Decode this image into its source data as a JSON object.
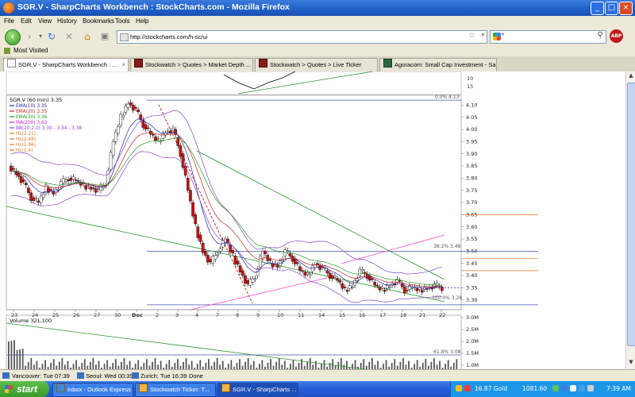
{
  "window": {
    "title": "SGR.V - SharpCharts Workbench : StockCharts.com - Mozilla Firefox"
  },
  "menu": [
    "File",
    "Edit",
    "View",
    "History",
    "Bookmarks",
    "Tools",
    "Help"
  ],
  "nav": {
    "url": "http://stockcharts.com/h-sc/ui",
    "search_value": ""
  },
  "bookmarks": {
    "most_visited": "Most Visited"
  },
  "tabs": [
    {
      "label": "SGR.V - SharpCharts Workbench : ...",
      "active": true
    },
    {
      "label": "Stockwatch > Quotes > Market Depth ...",
      "active": false
    },
    {
      "label": "Stockwatch > Quotes > Live Ticker",
      "active": false
    },
    {
      "label": "Agoracom: Small Cap Investment - San...",
      "active": false
    }
  ],
  "status": {
    "vancouver": "Vancouver: Tue 07:39",
    "seoul": "Seoul: Wed 00:39",
    "zurich": "Zurich: Tue 16:39",
    "state": "Done"
  },
  "taskbar": {
    "start": "start",
    "tasks": [
      "Inbox - Outlook Express",
      "Stockwatch Ticker: T...",
      "SGR.V - SharpCharts ..."
    ],
    "tray": {
      "gold": "16.87 Gold",
      "other": "1081.60",
      "time": "7:39 AM"
    }
  },
  "chart_data": {
    "type": "candlestick",
    "symbol_label": "SGR.V (60 min) 3.35",
    "legend": [
      {
        "label": "EMA(10) 3.35",
        "color": "#2222aa"
      },
      {
        "label": "EMA(20) 3.35",
        "color": "#cc2222"
      },
      {
        "label": "EMA(30) 3.36",
        "color": "#229922"
      },
      {
        "label": "MA(200) 3.63",
        "color": "#cc22cc"
      },
      {
        "label": "BB(20,2.0) 3.30 - 3.34 - 3.38",
        "color": "#8844cc"
      },
      {
        "label": "HL(2.25)",
        "color": "#dd7722"
      },
      {
        "label": "HL(2.48)",
        "color": "#dd7722"
      },
      {
        "label": "HL(1.96)",
        "color": "#dd7722"
      },
      {
        "label": "HL(1.4)",
        "color": "#dd7722"
      }
    ],
    "ylim": [
      3.26,
      4.14
    ],
    "y_ticks": [
      "4.10",
      "4.05",
      "4.00",
      "3.95",
      "3.90",
      "3.85",
      "3.80",
      "3.75",
      "3.70",
      "3.65",
      "3.60",
      "3.55",
      "3.50",
      "3.45",
      "3.40",
      "3.35",
      "3.30"
    ],
    "top_ticks": [
      "10",
      "15"
    ],
    "x_ticks": [
      "23",
      "24",
      "25",
      "26",
      "27",
      "30",
      "Dec",
      "2",
      "3",
      "4",
      "7",
      "8",
      "9",
      "10",
      "11",
      "14",
      "15",
      "16",
      "17",
      "18",
      "21",
      "22"
    ],
    "fib_labels": [
      "0.0% 4.13",
      "38.2% 3.48",
      "100.0% 3.28"
    ],
    "horizontal_levels": [
      3.65,
      3.5,
      3.47,
      3.42,
      3.35,
      3.28
    ],
    "price_path": [
      3.85,
      3.82,
      3.78,
      3.72,
      3.7,
      3.76,
      3.74,
      3.78,
      3.8,
      3.79,
      3.77,
      3.76,
      3.75,
      3.78,
      3.95,
      4.05,
      4.11,
      4.08,
      4.02,
      3.98,
      3.95,
      3.99,
      4.0,
      3.9,
      3.75,
      3.6,
      3.5,
      3.45,
      3.5,
      3.55,
      3.48,
      3.42,
      3.36,
      3.4,
      3.5,
      3.45,
      3.44,
      3.5,
      3.47,
      3.42,
      3.4,
      3.45,
      3.43,
      3.4,
      3.38,
      3.34,
      3.36,
      3.42,
      3.4,
      3.36,
      3.34,
      3.36,
      3.38,
      3.34,
      3.35,
      3.34,
      3.35,
      3.36,
      3.35
    ],
    "volume_label": "Volume 321,100",
    "volume_ticks": [
      "3.0M",
      "2.5M",
      "2.0M",
      "1.5M",
      "1.0M"
    ],
    "volume_fib_label": "61.8% 3.08"
  }
}
